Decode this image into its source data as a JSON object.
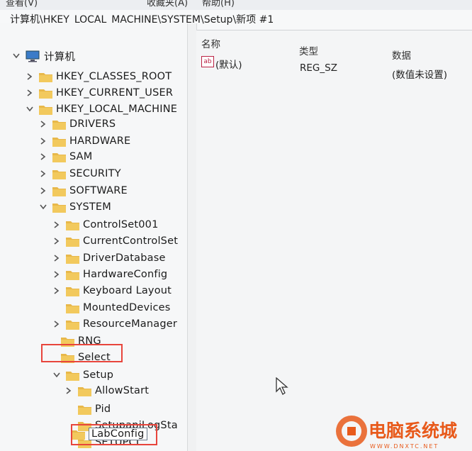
{
  "menu": [
    "查看(V)",
    "收藏夹(A)",
    "帮助(H)"
  ],
  "address": "计算机\\HKEY_LOCAL_MACHINE\\SYSTEM\\Setup\\新项 #1",
  "tree": {
    "root": "计算机",
    "hives": [
      "HKEY_CLASSES_ROOT",
      "HKEY_CURRENT_USER",
      "HKEY_LOCAL_MACHINE"
    ],
    "hklm_children": [
      "DRIVERS",
      "HARDWARE",
      "SAM",
      "SECURITY",
      "SOFTWARE",
      "SYSTEM"
    ],
    "system_children": [
      "ControlSet001",
      "CurrentControlSet",
      "DriverDatabase",
      "HardwareConfig",
      "Keyboard Layout",
      "MountedDevices",
      "ResourceManager",
      "RNG",
      "Select",
      "Setup"
    ],
    "setup_children": [
      "AllowStart",
      "Pid",
      "SetupapiLogSta",
      "SETUPCL"
    ],
    "editing_key": "LabConfig"
  },
  "values_pane": {
    "columns": {
      "name": "名称",
      "type": "类型",
      "data": "数据"
    },
    "rows": [
      {
        "name": "(默认)",
        "type": "REG_SZ",
        "data": "(数值未设置)"
      }
    ]
  },
  "watermark": {
    "title": "电脑系统城",
    "url": "WWW.DNXTC.NET"
  },
  "colors": {
    "folder": "#e8b84a",
    "highlight_box": "#e8453c",
    "watermark_orange": "#e85a1b"
  }
}
